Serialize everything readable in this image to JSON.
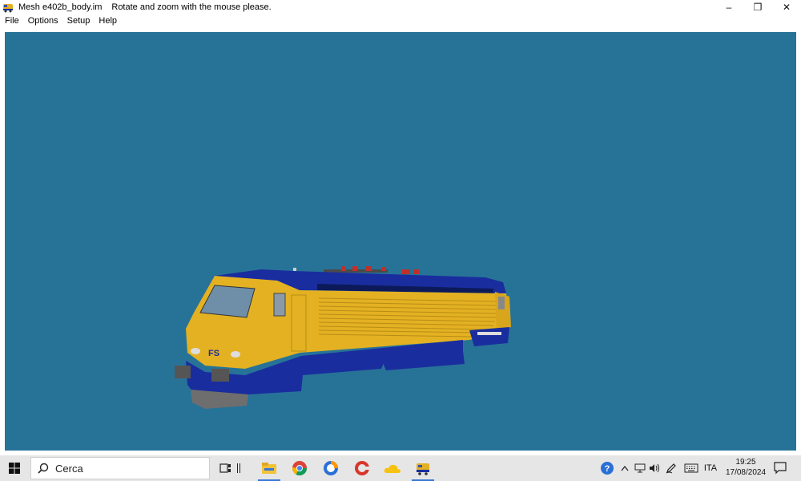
{
  "window": {
    "title": "Mesh e402b_body.im",
    "hint": "Rotate and zoom with the mouse please.",
    "icon": "locomotive-icon",
    "controls": {
      "minimize": "–",
      "restore": "❐",
      "close": "✕"
    }
  },
  "menu": {
    "items": [
      "File",
      "Options",
      "Setup",
      "Help"
    ]
  },
  "viewport": {
    "background": "#277398",
    "model": "locomotive-3d-model",
    "body_color": "#e3b122",
    "livery_color": "#1a2d9e",
    "logo": "FS"
  },
  "taskbar": {
    "search_placeholder": "Cerca",
    "apps": [
      "start-icon",
      "task-view-icon",
      "file-explorer-icon",
      "chrome-icon",
      "browser-icon",
      "ccleaner-icon",
      "onedrive-icon",
      "locomotive-app-icon"
    ],
    "tray": {
      "language": "ITA"
    },
    "clock": {
      "time": "19:25",
      "date": "17/08/2024"
    }
  }
}
